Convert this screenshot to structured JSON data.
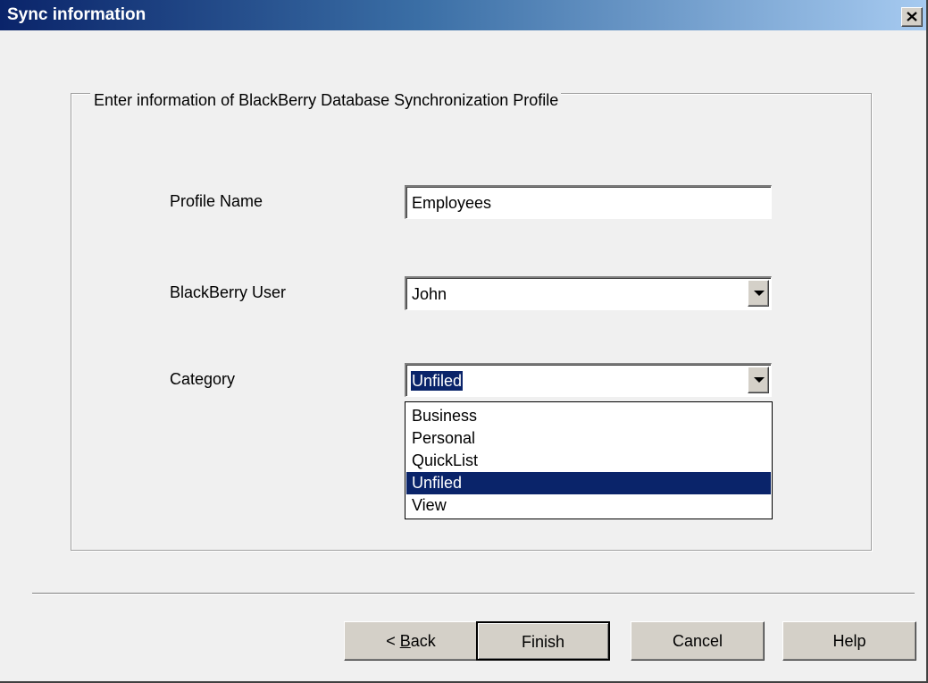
{
  "window": {
    "title": "Sync information",
    "close_icon": "close-icon"
  },
  "group": {
    "legend": "Enter information of BlackBerry Database Synchronization Profile"
  },
  "form": {
    "profile_name": {
      "label": "Profile Name",
      "value": "Employees"
    },
    "blackberry_user": {
      "label": "BlackBerry User",
      "value": "John"
    },
    "category": {
      "label": "Category",
      "value": "Unfiled",
      "options": [
        "Business",
        "Personal",
        "QuickList",
        "Unfiled",
        "View"
      ],
      "highlighted_option": "Unfiled"
    }
  },
  "buttons": {
    "back_prefix": "< ",
    "back_mnemonic": "B",
    "back_rest": "ack",
    "finish": "Finish",
    "cancel": "Cancel",
    "help": "Help"
  },
  "colors": {
    "selection": "#0a246a",
    "title_gradient_start": "#0a246a",
    "title_gradient_end": "#a6caf0",
    "dialog_background": "#f0f0f0",
    "button_face": "#d4d0c8"
  }
}
